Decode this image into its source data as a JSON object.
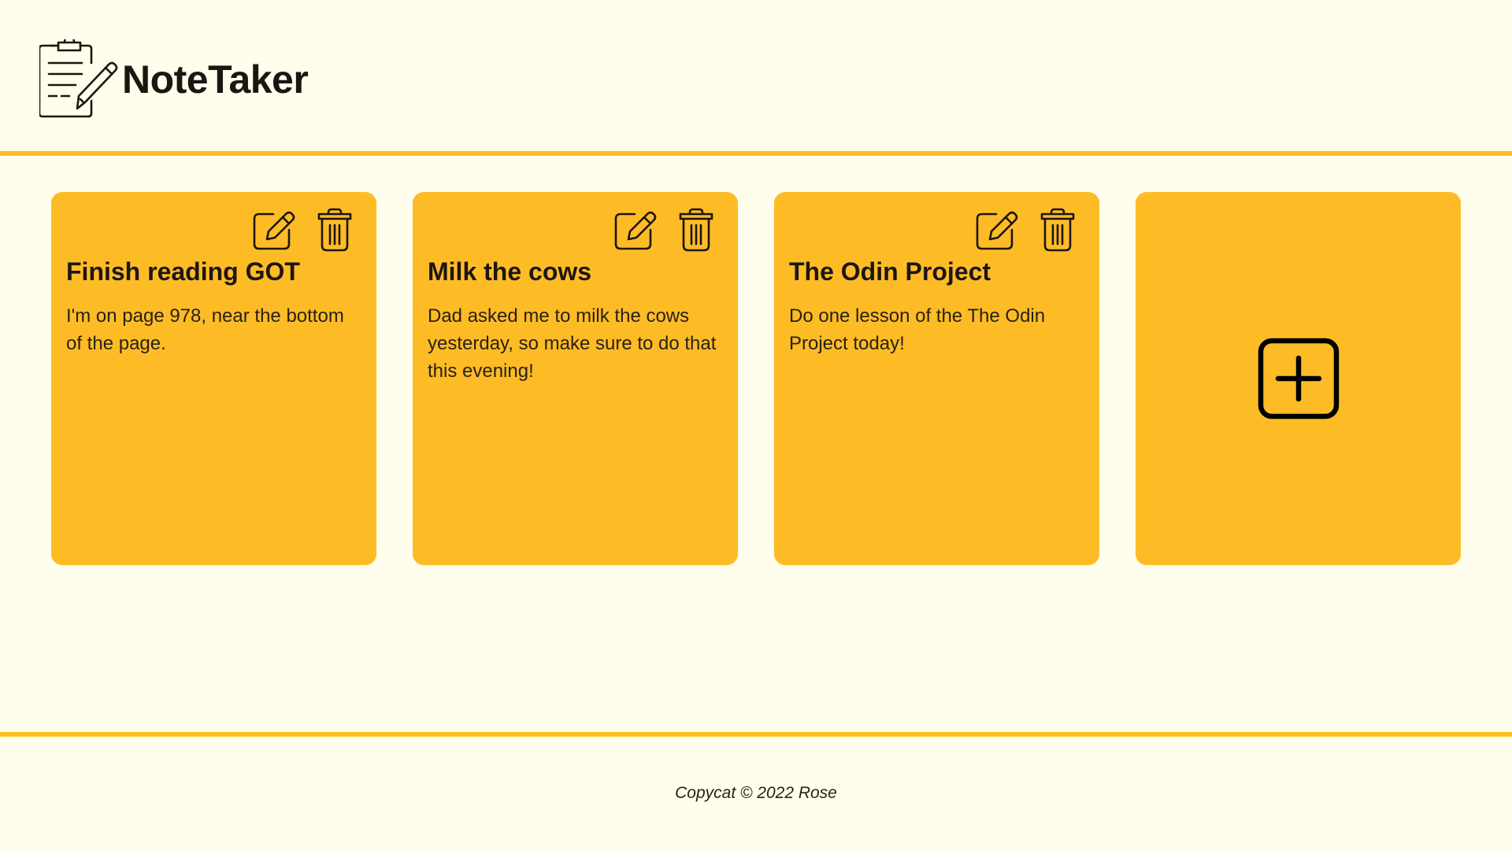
{
  "app": {
    "brand": "NoteTaker"
  },
  "notes": [
    {
      "title": "Finish reading GOT",
      "body": "I'm on page 978, near the bottom of the page."
    },
    {
      "title": "Milk the cows",
      "body": "Dad asked me to milk the cows yesterday, so make sure to do that this evening!"
    },
    {
      "title": "The Odin Project",
      "body": "Do one lesson of the The Odin Project today!"
    }
  ],
  "icons": {
    "logo": "clipboard-pencil-icon",
    "edit": "edit-icon",
    "delete": "trash-icon",
    "add": "plus-square-icon"
  },
  "colors": {
    "background": "#fffdeb",
    "accent": "#fcbf22",
    "card": "#fdbc26",
    "text": "#1d1511"
  },
  "footer": {
    "text": "Copycat © 2022 Rose"
  }
}
